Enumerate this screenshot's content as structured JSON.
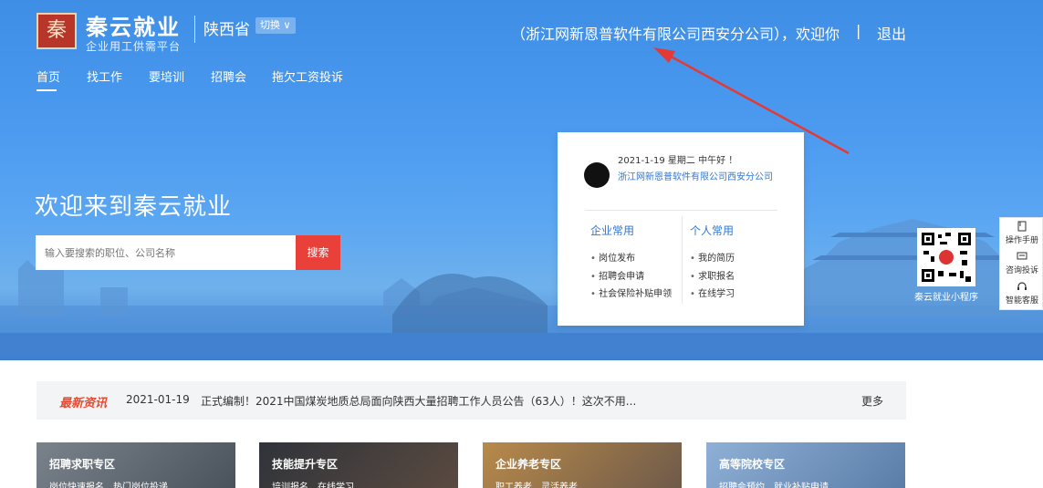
{
  "header": {
    "logo_char": "秦",
    "brand_name": "秦云就业",
    "brand_sub": "企业用工供需平台",
    "province": "陕西省",
    "switch_label": "切换",
    "company_greeting": "（浙江网新恩普软件有限公司西安分公司），欢迎你",
    "separator": "|",
    "logout_label": "退出"
  },
  "nav": {
    "items": [
      {
        "label": "首页"
      },
      {
        "label": "找工作"
      },
      {
        "label": "要培训"
      },
      {
        "label": "招聘会"
      },
      {
        "label": "拖欠工资投诉"
      }
    ]
  },
  "hero": {
    "welcome": "欢迎来到秦云就业",
    "search_placeholder": "输入要搜索的职位、公司名称",
    "search_button": "搜索"
  },
  "user_card": {
    "date_greeting": "2021-1-19 星期二 中午好 ！",
    "company": "浙江网新恩普软件有限公司西安分公司",
    "enterprise_title": "企业常用",
    "enterprise_items": [
      "岗位发布",
      "招聘会申请",
      "社会保险补贴申领"
    ],
    "personal_title": "个人常用",
    "personal_items": [
      "我的简历",
      "求职报名",
      "在线学习"
    ]
  },
  "qr": {
    "caption": "秦云就业小程序"
  },
  "side_tools": {
    "manual": "操作手册",
    "complaint": "咨询投诉",
    "service": "智能客服"
  },
  "news": {
    "tag": "最新资讯",
    "date": "2021-01-19",
    "text": "正式编制！2021中国煤炭地质总局面向陕西大量招聘工作人员公告（63人）！这次不用...",
    "more": "更多"
  },
  "zones": [
    {
      "title": "招聘求职专区",
      "sub": "岗位快速报名　热门岗位投递",
      "color": "#5a6370"
    },
    {
      "title": "技能提升专区",
      "sub": "培训报名　在线学习",
      "color": "#3a3e46"
    },
    {
      "title": "企业养老专区",
      "sub": "职工养老　灵活养老",
      "color": "#8a6a48"
    },
    {
      "title": "高等院校专区",
      "sub": "招聘会预约　就业补贴申请",
      "color": "#6a8fb8"
    }
  ],
  "colors": {
    "accent": "#2f77d6",
    "search_red": "#e9413a",
    "news_red": "#e84a2f",
    "annotation_arrow": "#e53935"
  }
}
